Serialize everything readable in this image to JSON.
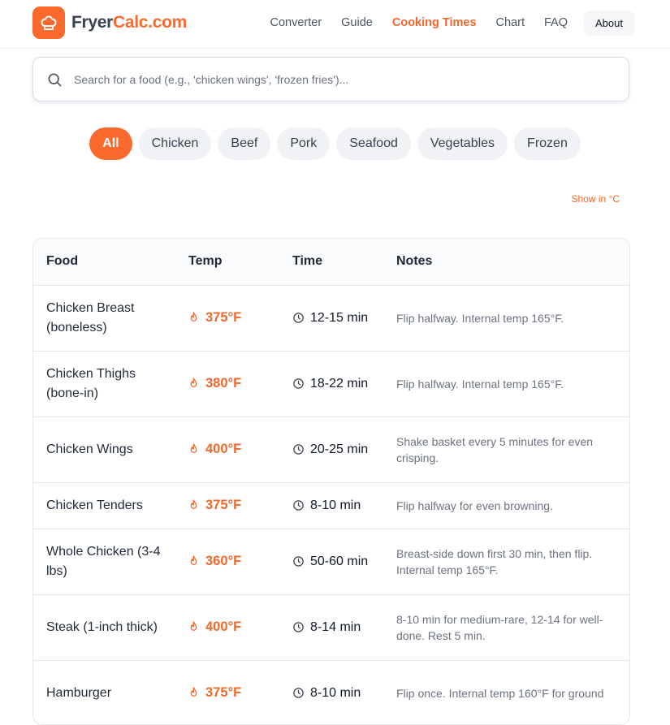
{
  "brand": {
    "name_main": "Fryer",
    "name_accent": "Calc.com",
    "color": "#fb6a2c"
  },
  "nav": {
    "items": [
      {
        "label": "Converter",
        "active": false
      },
      {
        "label": "Guide",
        "active": false
      },
      {
        "label": "Cooking Times",
        "active": true
      },
      {
        "label": "Chart",
        "active": false
      },
      {
        "label": "FAQ",
        "active": false
      }
    ],
    "about": "About"
  },
  "search": {
    "placeholder": "Search for a food (e.g., 'chicken wings', 'frozen fries')...",
    "value": ""
  },
  "filters": [
    {
      "label": "All",
      "active": true
    },
    {
      "label": "Chicken",
      "active": false
    },
    {
      "label": "Beef",
      "active": false
    },
    {
      "label": "Pork",
      "active": false
    },
    {
      "label": "Seafood",
      "active": false
    },
    {
      "label": "Vegetables",
      "active": false
    },
    {
      "label": "Frozen",
      "active": false
    }
  ],
  "unit_toggle": "Show in °C",
  "table": {
    "headers": {
      "food": "Food",
      "temp": "Temp",
      "time": "Time",
      "notes": "Notes"
    },
    "rows": [
      {
        "food": "Chicken Breast (boneless)",
        "temp": "375°F",
        "time": "12-15 min",
        "notes": "Flip halfway. Internal temp 165°F."
      },
      {
        "food": "Chicken Thighs (bone-in)",
        "temp": "380°F",
        "time": "18-22 min",
        "notes": "Flip halfway. Internal temp 165°F."
      },
      {
        "food": "Chicken Wings",
        "temp": "400°F",
        "time": "20-25 min",
        "notes": "Shake basket every 5 minutes for even crisping."
      },
      {
        "food": "Chicken Tenders",
        "temp": "375°F",
        "time": "8-10 min",
        "notes": "Flip halfway for even browning."
      },
      {
        "food": "Whole Chicken (3-4 lbs)",
        "temp": "360°F",
        "time": "50-60 min",
        "notes": "Breast-side down first 30 min, then flip. Internal temp 165°F."
      },
      {
        "food": "Steak (1-inch thick)",
        "temp": "400°F",
        "time": "8-14 min",
        "notes": "8-10 min for medium-rare, 12-14 for well-done. Rest 5 min."
      },
      {
        "food": "Hamburger",
        "temp": "375°F",
        "time": "8-10 min",
        "notes": "Flip once. Internal temp 160°F for ground"
      }
    ]
  },
  "icons": {
    "logo": "chef-hat-icon",
    "search": "search-icon",
    "temp": "flame-icon",
    "time": "clock-icon"
  }
}
